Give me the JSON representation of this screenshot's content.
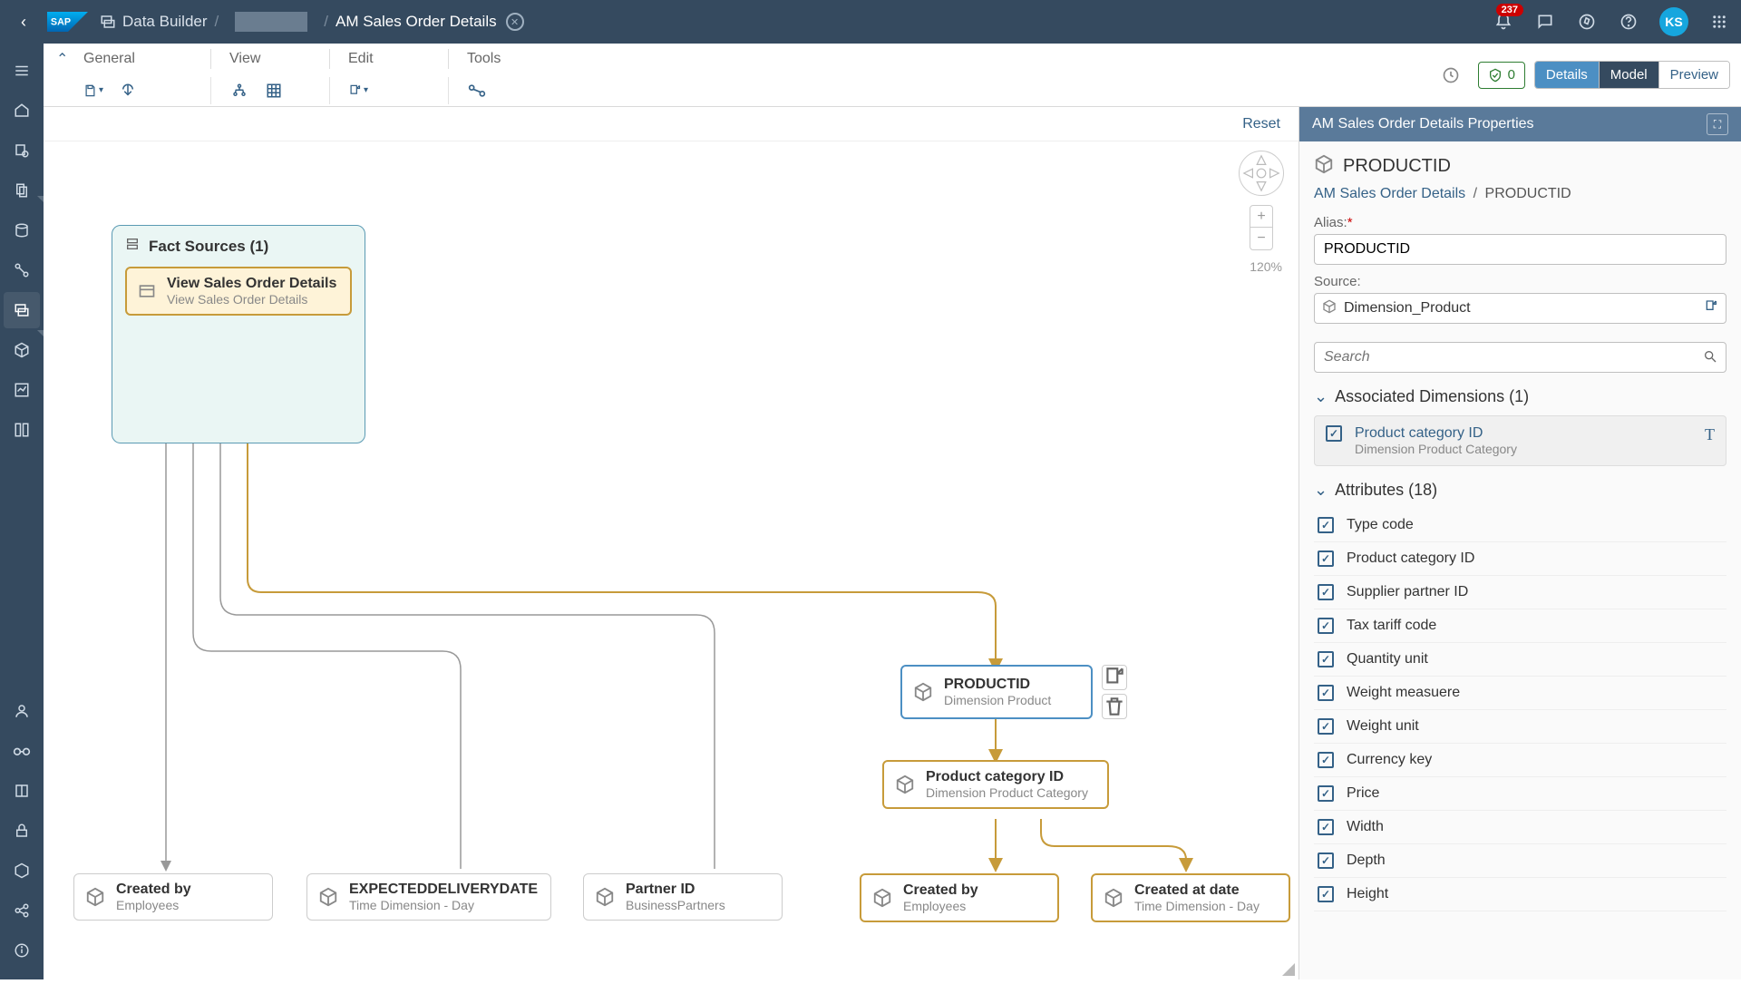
{
  "header": {
    "breadcrumb_module": "Data Builder",
    "title": "AM Sales Order Details",
    "notification_count": "237",
    "avatar_initials": "KS"
  },
  "menus": {
    "general": "General",
    "view": "View",
    "edit": "Edit",
    "tools": "Tools"
  },
  "toolbar_right": {
    "badge_count": "0",
    "details": "Details",
    "model": "Model",
    "preview": "Preview"
  },
  "canvas": {
    "reset": "Reset",
    "zoom": "120%",
    "fact_header": "Fact Sources (1)",
    "view_node": {
      "title": "View Sales Order Details",
      "sub": "View Sales Order Details"
    },
    "productid": {
      "title": "PRODUCTID",
      "sub": "Dimension Product"
    },
    "prodcat": {
      "title": "Product category ID",
      "sub": "Dimension Product Category"
    },
    "createdby1": {
      "title": "Created by",
      "sub": "Employees"
    },
    "expdel": {
      "title": "EXPECTEDDELIVERYDATE",
      "sub": "Time Dimension - Day"
    },
    "partner": {
      "title": "Partner ID",
      "sub": "BusinessPartners"
    },
    "createdby2": {
      "title": "Created by",
      "sub": "Employees"
    },
    "createdat": {
      "title": "Created at date",
      "sub": "Time Dimension - Day"
    }
  },
  "panel": {
    "header": "AM Sales Order Details Properties",
    "title": "PRODUCTID",
    "bc_parent": "AM Sales Order Details",
    "bc_current": "PRODUCTID",
    "alias_label": "Alias:",
    "alias_value": "PRODUCTID",
    "source_label": "Source:",
    "source_value": "Dimension_Product",
    "search_placeholder": "Search",
    "assoc_header": "Associated Dimensions (1)",
    "assoc_item": {
      "title": "Product category ID",
      "sub": "Dimension Product Category"
    },
    "attr_header": "Attributes (18)",
    "attrs": [
      "Type code",
      "Product category ID",
      "Supplier partner ID",
      "Tax tariff code",
      "Quantity unit",
      "Weight measuere",
      "Weight unit",
      "Currency key",
      "Price",
      "Width",
      "Depth",
      "Height"
    ]
  }
}
